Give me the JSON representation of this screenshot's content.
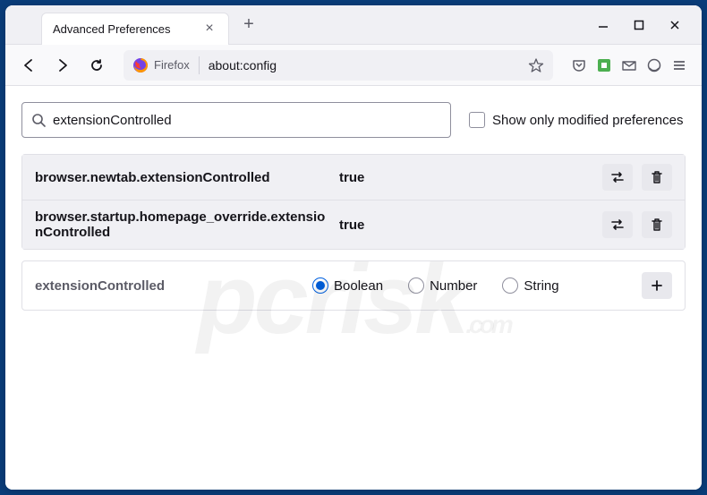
{
  "tab": {
    "title": "Advanced Preferences"
  },
  "urlbar": {
    "identity": "Firefox",
    "url": "about:config"
  },
  "search": {
    "value": "extensionControlled",
    "show_modified_label": "Show only modified preferences"
  },
  "prefs": [
    {
      "name": "browser.newtab.extensionControlled",
      "value": "true"
    },
    {
      "name": "browser.startup.homepage_override.extensionControlled",
      "value": "true"
    }
  ],
  "add": {
    "name": "extensionControlled",
    "types": [
      "Boolean",
      "Number",
      "String"
    ],
    "selected": "Boolean"
  },
  "watermark": {
    "brand": "pcrisk",
    "suffix": ".com"
  }
}
